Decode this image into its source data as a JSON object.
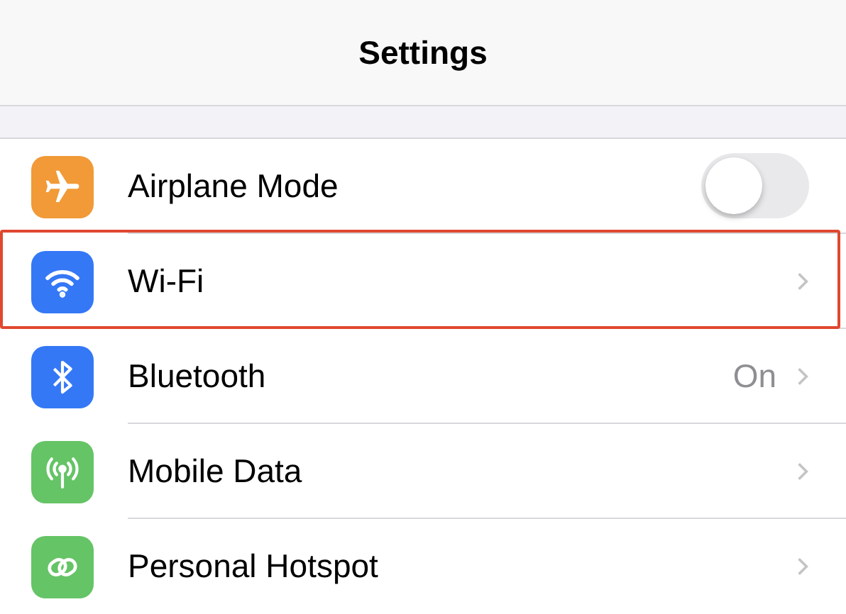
{
  "header": {
    "title": "Settings"
  },
  "rows": [
    {
      "kind": "toggle",
      "label": "Airplane Mode",
      "on": false,
      "highlighted": false
    },
    {
      "kind": "link",
      "label": "Wi-Fi",
      "highlighted": true
    },
    {
      "kind": "link",
      "label": "Bluetooth",
      "value": "On",
      "highlighted": false
    },
    {
      "kind": "link",
      "label": "Mobile Data",
      "highlighted": false
    },
    {
      "kind": "link",
      "label": "Personal Hotspot",
      "highlighted": false
    }
  ]
}
